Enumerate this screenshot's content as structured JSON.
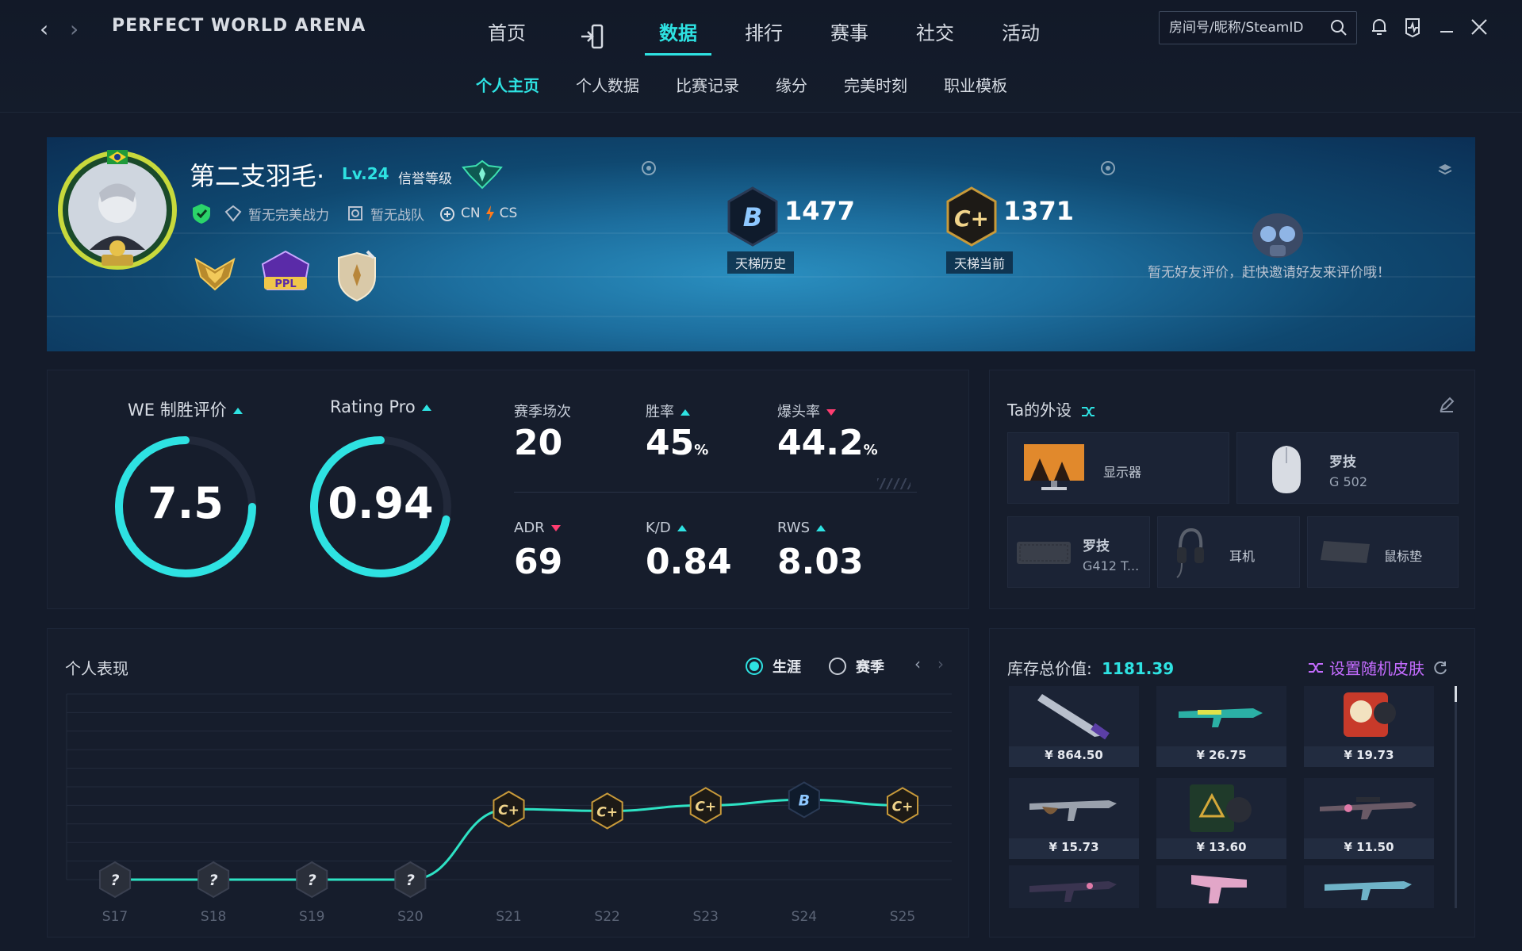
{
  "app": {
    "title": "PERFECT WORLD ARENA"
  },
  "nav": {
    "tabs": [
      {
        "label": "首页"
      },
      {
        "label": ""
      },
      {
        "label": "数据"
      },
      {
        "label": "排行"
      },
      {
        "label": "赛事"
      },
      {
        "label": "社交"
      },
      {
        "label": "活动"
      }
    ],
    "active": "数据"
  },
  "subnav": {
    "tabs": [
      {
        "label": "个人主页"
      },
      {
        "label": "个人数据"
      },
      {
        "label": "比赛记录"
      },
      {
        "label": "缘分"
      },
      {
        "label": "完美时刻"
      },
      {
        "label": "职业模板"
      }
    ]
  },
  "search": {
    "placeholder": "房间号/昵称/SteamID"
  },
  "profile": {
    "name": "第二支羽毛·",
    "level": "Lv.24",
    "trust_label": "信誉等级",
    "power": "暂无完美战力",
    "team": "暂无战队",
    "region": "CN",
    "game": "CS",
    "ladder_history": {
      "score": "1477",
      "label": "天梯历史",
      "rank": "B"
    },
    "ladder_current": {
      "score": "1371",
      "label": "天梯当前",
      "rank": "C+"
    },
    "friend_review": "暂无好友评价，赶快邀请好友来评价哦！"
  },
  "stats": {
    "we_label": "WE 制胜评价",
    "we_value": "7.5",
    "we_fraction": 0.75,
    "rating_label": "Rating Pro",
    "rating_value": "0.94",
    "rating_fraction": 0.72,
    "items": [
      {
        "label": "赛季场次",
        "value": "20",
        "unit": "",
        "trend": "none"
      },
      {
        "label": "胜率",
        "value": "45",
        "unit": "%",
        "trend": "up"
      },
      {
        "label": "爆头率",
        "value": "44.2",
        "unit": "%",
        "trend": "down"
      },
      {
        "label": "ADR",
        "value": "69",
        "unit": "",
        "trend": "down"
      },
      {
        "label": "K/D",
        "value": "0.84",
        "unit": "",
        "trend": "up"
      },
      {
        "label": "RWS",
        "value": "8.03",
        "unit": "",
        "trend": "up"
      }
    ]
  },
  "gear": {
    "title": "Ta的外设",
    "items": [
      {
        "name": "显示器"
      },
      {
        "brand": "罗技",
        "model": "G 502"
      },
      {
        "brand": "罗技",
        "model": "G412 T..."
      },
      {
        "name": "耳机"
      },
      {
        "name": "鼠标垫"
      }
    ]
  },
  "performance": {
    "title": "个人表现",
    "radio_career": "生涯",
    "radio_season": "赛季",
    "selected": "生涯"
  },
  "chart_data": {
    "type": "line",
    "categories": [
      "S17",
      "S18",
      "S19",
      "S20",
      "S21",
      "S22",
      "S23",
      "S24",
      "S25"
    ],
    "ranks": [
      "?",
      "?",
      "?",
      "?",
      "C+",
      "C+",
      "C+",
      "B",
      "C+"
    ],
    "values": [
      0,
      0,
      0,
      0,
      0.38,
      0.37,
      0.4,
      0.43,
      0.4
    ],
    "ylim": [
      0,
      1
    ],
    "grid": true
  },
  "inventory": {
    "label": "库存总价值:",
    "total": "1181.39",
    "random_label": "设置随机皮肤",
    "items": [
      {
        "price": "¥ 864.50"
      },
      {
        "price": "¥ 26.75"
      },
      {
        "price": "¥ 19.73"
      },
      {
        "price": "¥ 15.73"
      },
      {
        "price": "¥ 13.60"
      },
      {
        "price": "¥ 11.50"
      },
      {
        "price": ""
      },
      {
        "price": ""
      },
      {
        "price": ""
      }
    ]
  },
  "colors": {
    "accent": "#2ee2e2",
    "down": "#ff3d71",
    "random": "#c46cff"
  }
}
